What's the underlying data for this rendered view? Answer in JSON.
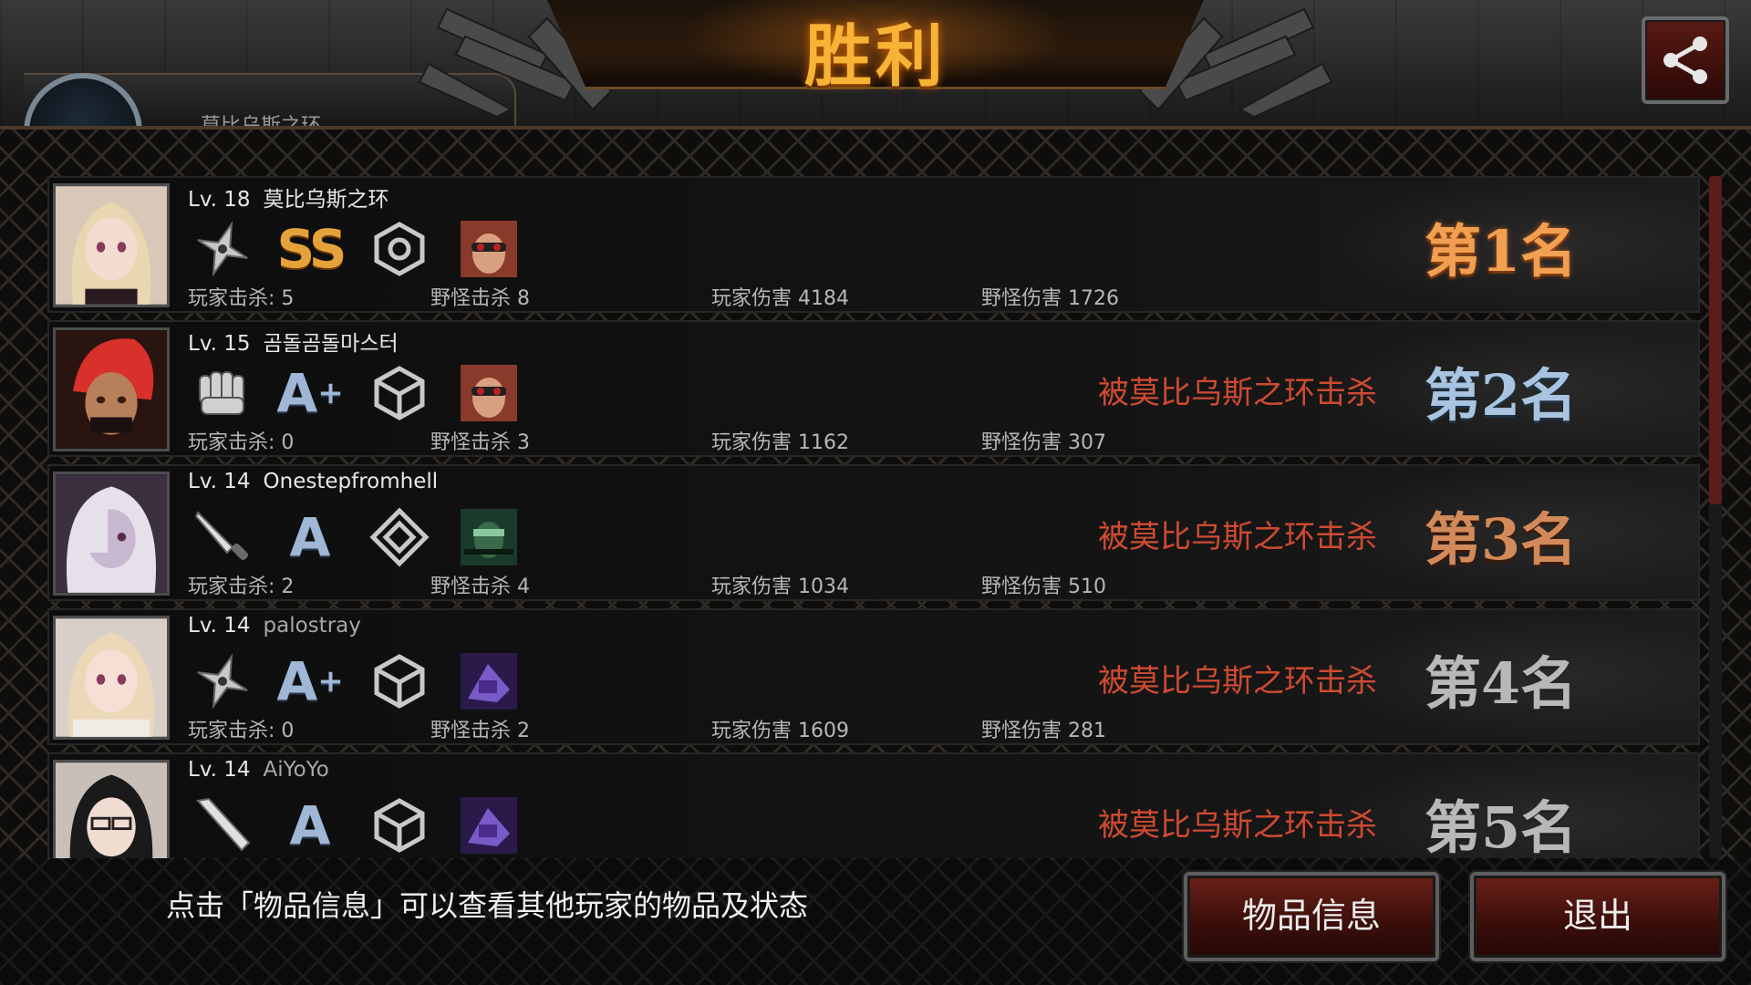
{
  "header": {
    "title": "胜利",
    "player_tab_name": "莫比乌斯之环"
  },
  "players": [
    {
      "level": "Lv. 18",
      "name": "莫比乌斯之环",
      "name_dim": false,
      "weapon_icon": "shuriken-icon",
      "grade": "SS",
      "grade_plus": "",
      "armor_icon": "triad-emblem-icon",
      "pet_icon": "goggles-portrait-icon",
      "player_kills": "玩家击杀: 5",
      "monster_kills": "野怪击杀 8",
      "player_damage": "玩家伤害 4184",
      "monster_damage": "野怪伤害 1726",
      "killed_by": "",
      "rank": "第1名"
    },
    {
      "level": "Lv. 15",
      "name": "곰돌곰돌마스터",
      "name_dim": false,
      "weapon_icon": "fist-icon",
      "grade": "A",
      "grade_plus": "+",
      "armor_icon": "cube-emblem-icon",
      "pet_icon": "goggles-portrait-icon",
      "player_kills": "玩家击杀: 0",
      "monster_kills": "野怪击杀 3",
      "player_damage": "玩家伤害 1162",
      "monster_damage": "野怪伤害 307",
      "killed_by": "被莫比乌斯之环击杀",
      "rank": "第2名"
    },
    {
      "level": "Lv. 14",
      "name": "Onestepfromhell",
      "name_dim": false,
      "weapon_icon": "knife-icon",
      "grade": "A",
      "grade_plus": "",
      "armor_icon": "diamond-emblem-icon",
      "pet_icon": "soldier-portrait-icon",
      "player_kills": "玩家击杀: 2",
      "monster_kills": "野怪击杀 4",
      "player_damage": "玩家伤害 1034",
      "monster_damage": "野怪伤害 510",
      "killed_by": "被莫比乌斯之环击杀",
      "rank": "第3名"
    },
    {
      "level": "Lv. 14",
      "name": "palostray",
      "name_dim": true,
      "weapon_icon": "shuriken-icon",
      "grade": "A",
      "grade_plus": "+",
      "armor_icon": "cube-emblem-icon",
      "pet_icon": "purple-gear-icon",
      "player_kills": "玩家击杀: 0",
      "monster_kills": "野怪击杀 2",
      "player_damage": "玩家伤害 1609",
      "monster_damage": "野怪伤害 281",
      "killed_by": "被莫比乌斯之环击杀",
      "rank": "第4名"
    },
    {
      "level": "Lv. 14",
      "name": "AiYoYo",
      "name_dim": true,
      "weapon_icon": "bat-icon",
      "grade": "A",
      "grade_plus": "",
      "armor_icon": "cube-emblem-icon",
      "pet_icon": "purple-gear-icon",
      "player_kills": "",
      "monster_kills": "",
      "player_damage": "",
      "monster_damage": "",
      "killed_by": "被莫比乌斯之环击杀",
      "rank": "第5名"
    }
  ],
  "footer": {
    "hint": "点击「物品信息」可以查看其他玩家的物品及状态",
    "items_button": "物品信息",
    "exit_button": "退出"
  },
  "colors": {
    "title": "#f6b335",
    "killed_text": "#cf4a32",
    "button_bg": "#5a1a14"
  }
}
